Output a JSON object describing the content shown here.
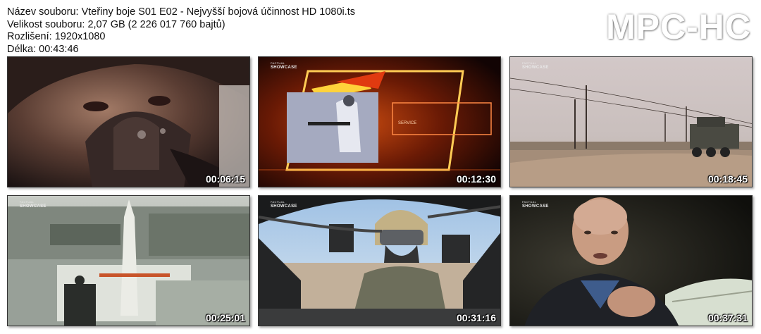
{
  "file_info": {
    "name_line": "Název souboru: Vteřiny boje S01 E02 - Nejvyšší bojová účinnost HD 1080i.ts",
    "size_line": "Velikost souboru: 2,07 GB (2 226 017 760 bajtů)",
    "resolution_line": "Rozlišení: 1920x1080",
    "duration_line": "Délka: 00:43:46"
  },
  "logo": "MPC-HC",
  "channel_logo": {
    "small": "FACTUAL",
    "main": "SHOWCASE"
  },
  "thumbnails": [
    {
      "timestamp": "00:06:15",
      "scene": "pilot-mask-icon"
    },
    {
      "timestamp": "00:12:30",
      "scene": "soldier-graphic-icon"
    },
    {
      "timestamp": "00:18:45",
      "scene": "armored-vehicle-icon"
    },
    {
      "timestamp": "00:25:01",
      "scene": "warship-missile-icon"
    },
    {
      "timestamp": "00:31:16",
      "scene": "helicopter-pilot-icon"
    },
    {
      "timestamp": "00:37:31",
      "scene": "interview-man-icon"
    }
  ]
}
